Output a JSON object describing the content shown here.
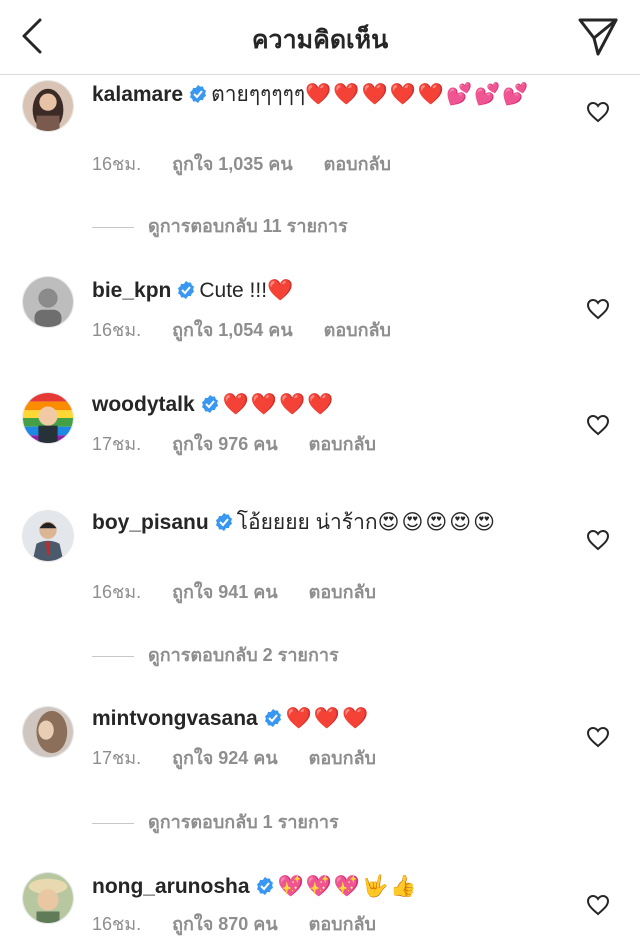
{
  "header": {
    "title": "ความคิดเห็น"
  },
  "comments": [
    {
      "username": "kalamare",
      "text": "ตายๆๆๆๆๆ",
      "emoji": "❤️❤️❤️❤️❤️💕💕💕",
      "time": "16ชม.",
      "likes": "ถูกใจ 1,035 คน",
      "reply": "ตอบกลับ",
      "view_replies": "ดูการตอบกลับ 11 รายการ"
    },
    {
      "username": "bie_kpn",
      "text": "Cute !!!",
      "emoji": "❤️",
      "time": "16ชม.",
      "likes": "ถูกใจ 1,054 คน",
      "reply": "ตอบกลับ"
    },
    {
      "username": "woodytalk",
      "text": "",
      "emoji": "❤️❤️❤️❤️",
      "time": "17ชม.",
      "likes": "ถูกใจ 976 คน",
      "reply": "ตอบกลับ"
    },
    {
      "username": "boy_pisanu",
      "text": "โอ้ยยยย น่าร้าก",
      "emoji": "😍😍😍😍😍",
      "time": "16ชม.",
      "likes": "ถูกใจ 941 คน",
      "reply": "ตอบกลับ",
      "view_replies": "ดูการตอบกลับ 2 รายการ"
    },
    {
      "username": "mintvongvasana",
      "text": "",
      "emoji": "❤️❤️❤️",
      "time": "17ชม.",
      "likes": "ถูกใจ 924 คน",
      "reply": "ตอบกลับ",
      "view_replies": "ดูการตอบกลับ 1 รายการ"
    },
    {
      "username": "nong_arunosha",
      "text": "",
      "emoji": "💖💖💖🤟👍",
      "time": "16ชม.",
      "likes": "ถูกใจ 870 คน",
      "reply": "ตอบกลับ"
    }
  ],
  "icons": {
    "back": "chevron-left-icon",
    "send": "paper-plane-icon",
    "verified": "verified-badge-icon",
    "like": "heart-outline-icon"
  },
  "colors": {
    "verified": "#3897f0",
    "muted": "#8e8e8e",
    "heart": "#ed4956"
  }
}
